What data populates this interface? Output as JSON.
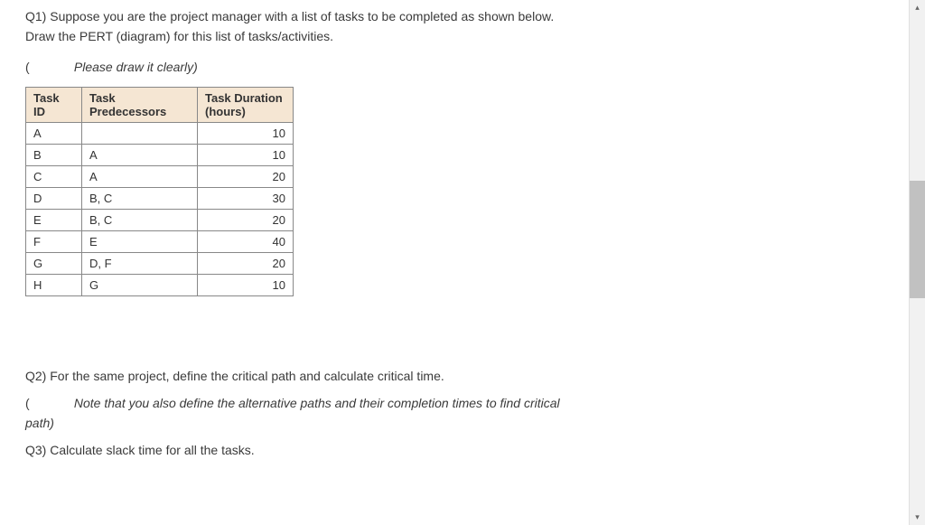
{
  "q1": {
    "line1": "Q1) Suppose you are the project manager with a list of tasks to be completed as shown below.",
    "line2": "Draw the PERT (diagram) for this list of tasks/activities.",
    "paren": "(",
    "note": "Please draw it clearly)"
  },
  "table": {
    "headers": {
      "id": "Task ID",
      "pred": "Task Predecessors",
      "dur": "Task Duration (hours)"
    },
    "rows": [
      {
        "id": "A",
        "pred": "",
        "dur": "10"
      },
      {
        "id": "B",
        "pred": "A",
        "dur": "10"
      },
      {
        "id": "C",
        "pred": "A",
        "dur": "20"
      },
      {
        "id": "D",
        "pred": "B, C",
        "dur": "30"
      },
      {
        "id": "E",
        "pred": "B, C",
        "dur": "20"
      },
      {
        "id": "F",
        "pred": "E",
        "dur": "40"
      },
      {
        "id": "G",
        "pred": "D, F",
        "dur": "20"
      },
      {
        "id": "H",
        "pred": "G",
        "dur": "10"
      }
    ]
  },
  "q2": {
    "text": "Q2) For the same project, define the critical path and calculate critical time.",
    "paren": "(",
    "note": "Note that you also define the alternative paths and their completion times to find critical",
    "path": "path)"
  },
  "q3": {
    "text": "Q3) Calculate slack time for all the tasks."
  },
  "scroll": {
    "up": "▴",
    "down": "▾"
  }
}
